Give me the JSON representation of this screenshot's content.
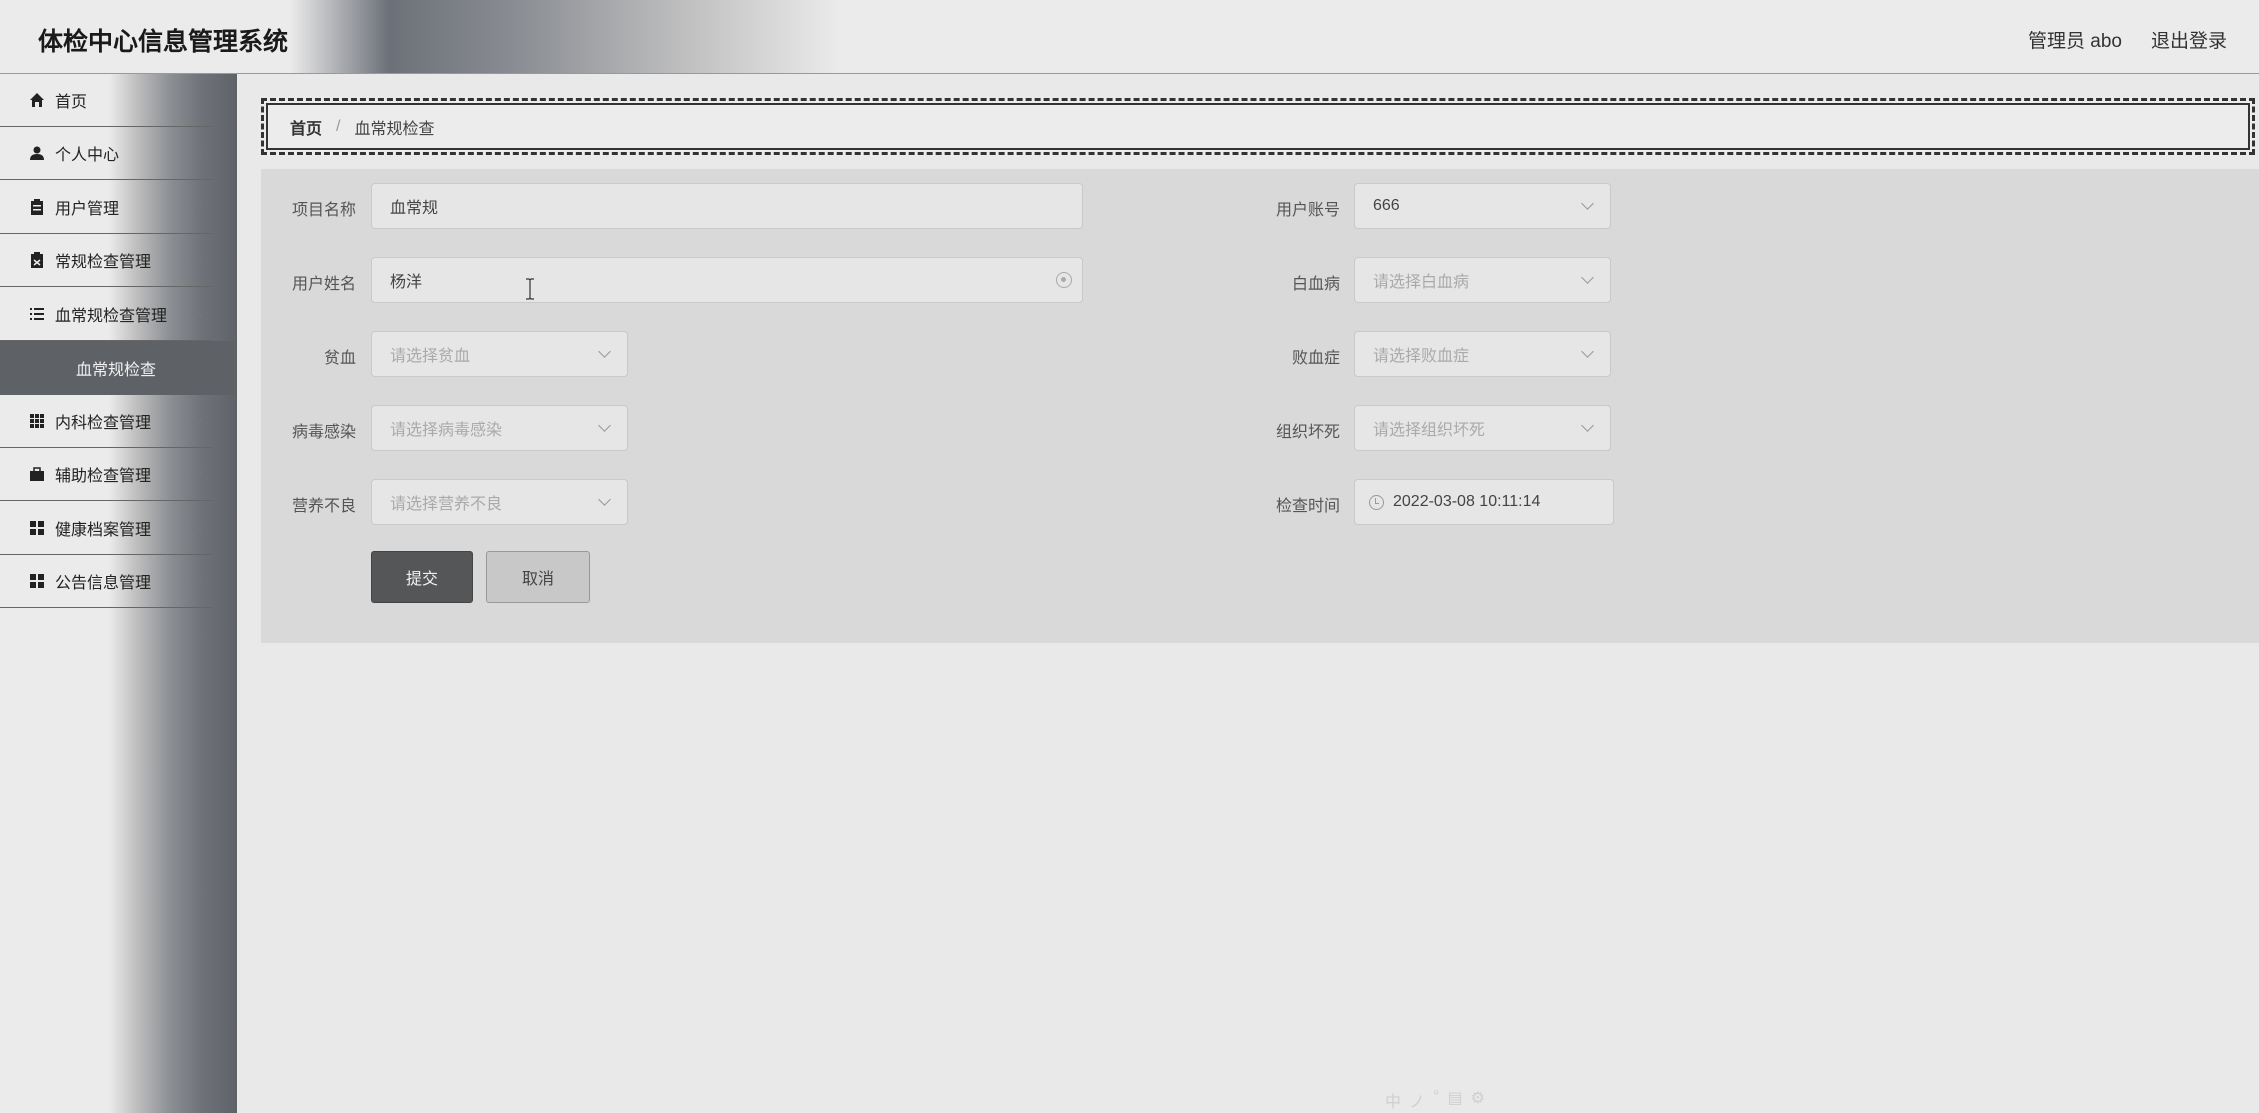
{
  "header": {
    "app_title": "体检中心信息管理系统",
    "user_label": "管理员 abo",
    "logout_label": "退出登录"
  },
  "sidebar": {
    "items": [
      {
        "label": "首页",
        "icon": "home-icon"
      },
      {
        "label": "个人中心",
        "icon": "user-icon"
      },
      {
        "label": "用户管理",
        "icon": "clipboard-icon"
      },
      {
        "label": "常规检查管理",
        "icon": "checklist-icon"
      },
      {
        "label": "血常规检查管理",
        "icon": "list-icon"
      },
      {
        "label": "内科检查管理",
        "icon": "grid-icon"
      },
      {
        "label": "辅助检查管理",
        "icon": "briefcase-icon"
      },
      {
        "label": "健康档案管理",
        "icon": "apps-icon"
      },
      {
        "label": "公告信息管理",
        "icon": "apps-icon"
      }
    ],
    "active_sub": "血常规检查"
  },
  "breadcrumb": {
    "home": "首页",
    "separator": "/",
    "current": "血常规检查"
  },
  "form": {
    "project_name": {
      "label": "项目名称",
      "value": "血常规"
    },
    "user_account": {
      "label": "用户账号",
      "value": "666"
    },
    "user_name": {
      "label": "用户姓名",
      "value": "杨洋"
    },
    "leukemia": {
      "label": "白血病",
      "placeholder": "请选择白血病"
    },
    "anemia": {
      "label": "贫血",
      "placeholder": "请选择贫血"
    },
    "sepsis": {
      "label": "败血症",
      "placeholder": "请选择败血症"
    },
    "viral_infection": {
      "label": "病毒感染",
      "placeholder": "请选择病毒感染"
    },
    "necrosis": {
      "label": "组织坏死",
      "placeholder": "请选择组织坏死"
    },
    "malnutrition": {
      "label": "营养不良",
      "placeholder": "请选择营养不良"
    },
    "check_time": {
      "label": "检查时间",
      "value": "2022-03-08 10:11:14"
    },
    "submit_label": "提交",
    "cancel_label": "取消"
  },
  "tray": [
    "中",
    "ノ",
    "°",
    "▤",
    "⚙"
  ]
}
